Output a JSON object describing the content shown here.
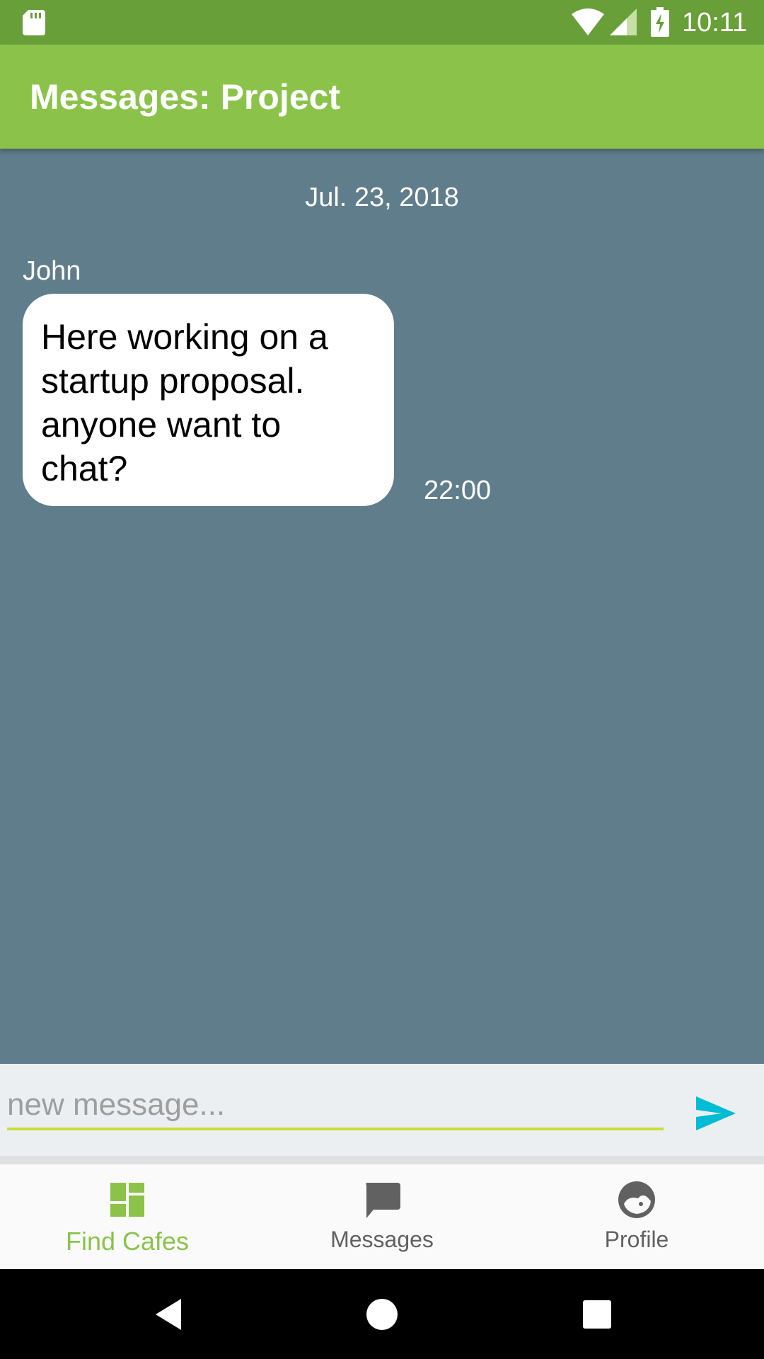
{
  "status_bar": {
    "time": "10:11",
    "icons": [
      "sd-card-icon",
      "wifi-icon",
      "signal-icon",
      "battery-charging-icon"
    ]
  },
  "app_bar": {
    "title": "Messages: Project",
    "color": "#8bc34a"
  },
  "chat": {
    "background_color": "#607d8b",
    "date": "Jul. 23, 2018",
    "messages": [
      {
        "sender": "John",
        "lines": [
          "Here working on a",
          "startup proposal.",
          "anyone want to",
          "chat?"
        ],
        "time": "22:00"
      }
    ]
  },
  "composer": {
    "placeholder": "new message...",
    "value": "",
    "send_icon": "send-icon",
    "send_color": "#00bcd4"
  },
  "bottom_nav": {
    "items": [
      {
        "label": "Find Cafes",
        "icon": "dashboard-icon",
        "active": true
      },
      {
        "label": "Messages",
        "icon": "chat-icon",
        "active": false
      },
      {
        "label": "Profile",
        "icon": "face-icon",
        "active": false
      }
    ],
    "active_color": "#8bc34a",
    "inactive_color": "#616161"
  },
  "system_nav": {
    "buttons": [
      "back-icon",
      "home-icon",
      "recents-icon"
    ]
  }
}
